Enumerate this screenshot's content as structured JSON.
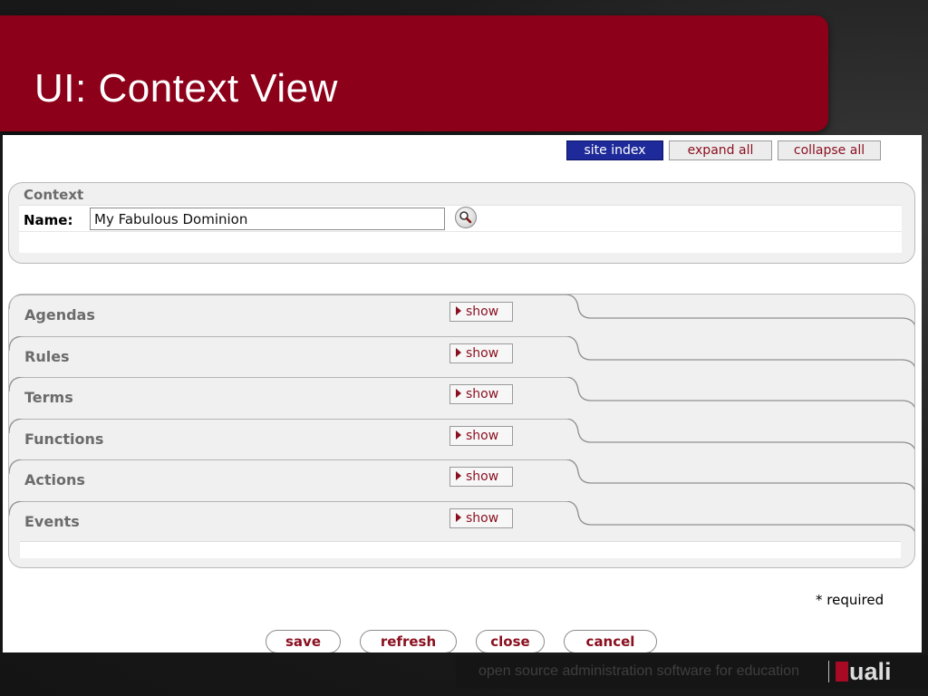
{
  "slide": {
    "title": "UI: Context View"
  },
  "toolbar": {
    "site_index": "site index",
    "expand_all": "expand all",
    "collapse_all": "collapse all"
  },
  "context": {
    "title": "Context",
    "name_label": "Name:",
    "name_value": "My Fabulous Dominion",
    "lookup_icon": "magnifier-icon"
  },
  "sections": [
    {
      "label": "Agendas",
      "toggle": "show"
    },
    {
      "label": "Rules",
      "toggle": "show"
    },
    {
      "label": "Terms",
      "toggle": "show"
    },
    {
      "label": "Functions",
      "toggle": "show"
    },
    {
      "label": "Actions",
      "toggle": "show"
    },
    {
      "label": "Events",
      "toggle": "show"
    }
  ],
  "required_note": "* required",
  "actions": {
    "save": "save",
    "refresh": "refresh",
    "close": "close",
    "cancel": "cancel"
  },
  "footer": {
    "tagline": "open source administration software for education",
    "logo_text": "uali"
  },
  "colors": {
    "banner": "#8c0019",
    "accent_text": "#8a0f1f",
    "site_index_bg": "#1e2a99"
  }
}
